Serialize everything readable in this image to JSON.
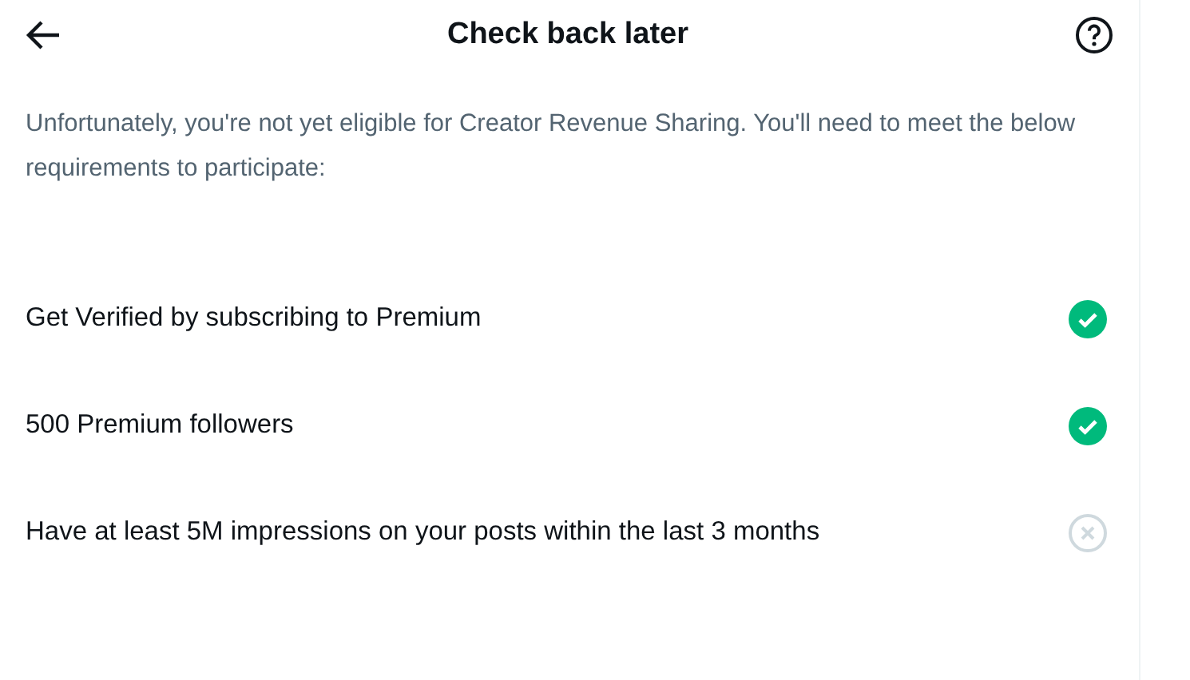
{
  "header": {
    "title": "Check back later"
  },
  "description": "Unfortunately, you're not yet eligible for Creator Revenue Sharing. You'll need to meet the below requirements to participate:",
  "requirements": [
    {
      "label": "Get Verified by subscribing to Premium",
      "met": true
    },
    {
      "label": "500 Premium followers",
      "met": true
    },
    {
      "label": "Have at least 5M impressions on your posts within the last 3 months",
      "met": false
    }
  ]
}
